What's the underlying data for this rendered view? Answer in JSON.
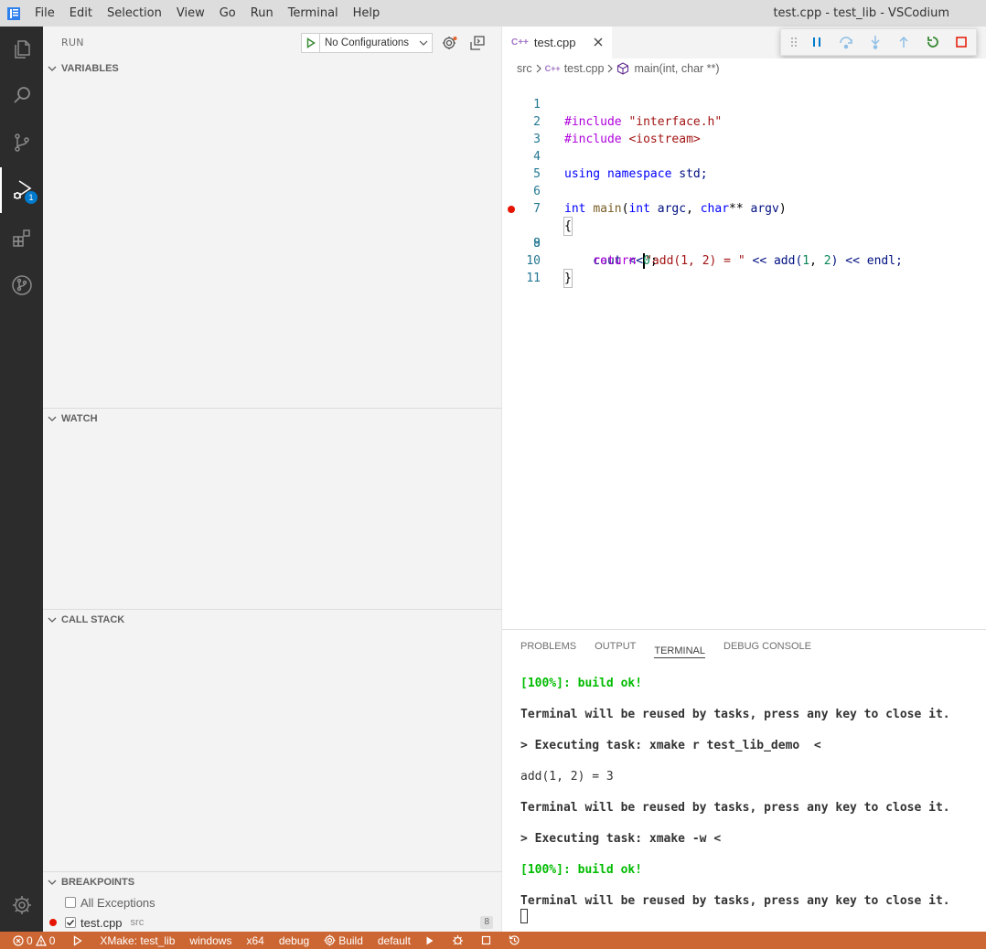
{
  "window_title": "test.cpp - test_lib - VSCodium",
  "menu": [
    "File",
    "Edit",
    "Selection",
    "View",
    "Go",
    "Run",
    "Terminal",
    "Help"
  ],
  "activity_bar": {
    "icons": [
      "explorer-icon",
      "search-icon",
      "source-control-icon",
      "run-debug-icon",
      "extensions-icon",
      "git-graph-icon",
      "settings-gear-icon"
    ],
    "debug_badge": "1"
  },
  "sidebar": {
    "title": "RUN",
    "config_label": "No Configurations",
    "sections": {
      "variables": "VARIABLES",
      "watch": "WATCH",
      "call_stack": "CALL STACK",
      "breakpoints": "BREAKPOINTS"
    },
    "breakpoints": {
      "all_exceptions": "All Exceptions",
      "file_name": "test.cpp",
      "file_dir": "src",
      "line": "8"
    }
  },
  "editor": {
    "tab_icon": "C++",
    "tab_label": "test.cpp",
    "breadcrumb": {
      "folder": "src",
      "file": "test.cpp",
      "symbol": "main(int, char **)"
    },
    "line_numbers": [
      "1",
      "2",
      "3",
      "4",
      "5",
      "6",
      "7",
      "8",
      "9",
      "10",
      "11"
    ],
    "code": {
      "l1_dir": "#include",
      "l1_str": "\"interface.h\"",
      "l2_dir": "#include",
      "l2_str": "<iostream>",
      "l4_kw1": "using",
      "l4_kw2": "namespace",
      "l4_rest": "std;",
      "l6_kw1": "int",
      "l6_fn": "main",
      "l6_p1": "(",
      "l6_kw2": "int",
      "l6_argc": "argc",
      "l6_comma": ", ",
      "l6_kw3": "char",
      "l6_stars": "**",
      "l6_argv": "argv",
      "l6_close": ")",
      "l7": "{",
      "l8_a": "    cout <<",
      "l8_str": "\"add(1, 2) = \"",
      "l8_b": " << add(",
      "l8_n1": "1",
      "l8_c": ", ",
      "l8_n2": "2",
      "l8_d": ") << endl;",
      "l9_kw": "    return",
      "l9_sp": " ",
      "l9_num": "0",
      "l9_semi": ";",
      "l10": "}"
    }
  },
  "panel": {
    "tabs": [
      "PROBLEMS",
      "OUTPUT",
      "TERMINAL",
      "DEBUG CONSOLE"
    ],
    "terminal_lines": [
      "[100%]: build ok!",
      "Terminal will be reused by tasks, press any key to close it.",
      "> Executing task: xmake r test_lib_demo  <",
      "add(1, 2) = 3",
      "Terminal will be reused by tasks, press any key to close it.",
      "> Executing task: xmake -w <",
      "[100%]: build ok!",
      "Terminal will be reused by tasks, press any key to close it."
    ]
  },
  "statusbar": {
    "errors": "0",
    "warnings": "0",
    "project": "XMake: test_lib",
    "platform": "windows",
    "arch": "x64",
    "mode": "debug",
    "build": "Build",
    "target": "default"
  },
  "colors": {
    "statusbar": "#cc6633",
    "activity_bar": "#2c2c2c",
    "breakpoint": "#e51400",
    "accent": "#007acc"
  }
}
